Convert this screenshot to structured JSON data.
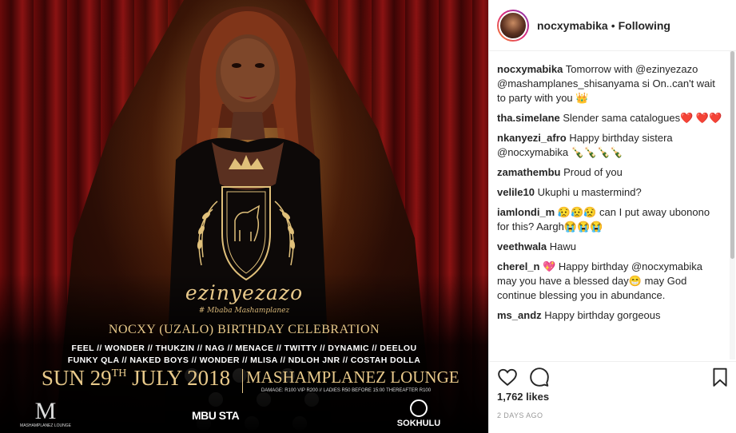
{
  "post": {
    "flyer": {
      "brand_script": "ezinyezazo",
      "brand_sub": "# Mbaba Mashamplanez",
      "event_title": "NOCXY (UZALO) BIRTHDAY CELEBRATION",
      "lineup_line1": "FEEL // WONDER // THUKZIN // NAG // MENACE // TWITTY // DYNAMIC // DEELOU",
      "lineup_line2": "FUNKY QLA // NAKED BOYS // WONDER // MLISA // NDLOH JNR // COSTAH DOLLA",
      "date_prefix": "SUN 29",
      "date_sup": "TH",
      "date_suffix": " JULY 2018",
      "venue": "MASHAMPLANEZ LOUNGE",
      "prices": "DAMAGE: R100 VIP R200 // LADIES R50 BEFORE 15:00 THEREAFTER R100",
      "logo_m": "M",
      "logo_m_text": "MASHAMPLANEZ LOUNGE",
      "logo_mbu": "MBU STA",
      "logo_sokhulu": "SOKHULU"
    }
  },
  "header": {
    "username": "nocxymabika",
    "dot": "•",
    "follow_status": "Following"
  },
  "comments": [
    {
      "user": "nocxymabika",
      "text": " Tomorrow with @ezinyezazo @mashamplanes_shisanyama si On..can't wait to party with you 👑"
    },
    {
      "user": "tha.simelane",
      "text": " Slender sama catalogues❤️ ❤️❤️"
    },
    {
      "user": "nkanyezi_afro",
      "text": " Happy birthday sistera @nocxymabika 🍾🍾🍾🍾"
    },
    {
      "user": "zamathembu",
      "text": " Proud of you"
    },
    {
      "user": "velile10",
      "text": " Ukuphi u mastermind?"
    },
    {
      "user": "iamlondi_m",
      "text": " 😥😥😥 can I put away ubonono for this? Aargh😭😭😭"
    },
    {
      "user": "veethwala",
      "text": " Hawu"
    },
    {
      "user": "cherel_n",
      "text": " 💖 Happy birthday @nocxymabika may you have a blessed day😁 may God continue blessing you in abundance."
    },
    {
      "user": "ms_andz",
      "text": " Happy birthday gorgeous"
    }
  ],
  "likes_text": "1,762 likes",
  "timestamp": "2 DAYS AGO",
  "icons": {
    "like": "heart-icon",
    "comment": "comment-icon",
    "save": "bookmark-icon"
  }
}
